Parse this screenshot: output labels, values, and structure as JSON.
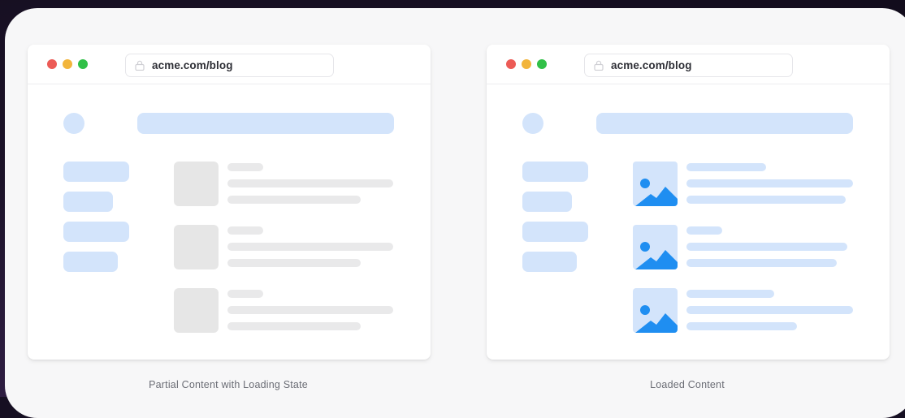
{
  "panels": [
    {
      "url": "acme.com/blog",
      "caption": "Partial Content with Loading State",
      "state": "loading"
    },
    {
      "url": "acme.com/blog",
      "caption": "Loaded Content",
      "state": "loaded"
    }
  ],
  "icons": {
    "url_lock": "lock-icon",
    "thumbnail": "image-icon"
  },
  "colors": {
    "skeleton_blue": "#d3e4fb",
    "skeleton_gray": "#e6e6e6",
    "image_accent": "#1f8ef1",
    "close_dot": "#ec5b56",
    "minimize_dot": "#f2b53c",
    "maximize_dot": "#31c048"
  }
}
